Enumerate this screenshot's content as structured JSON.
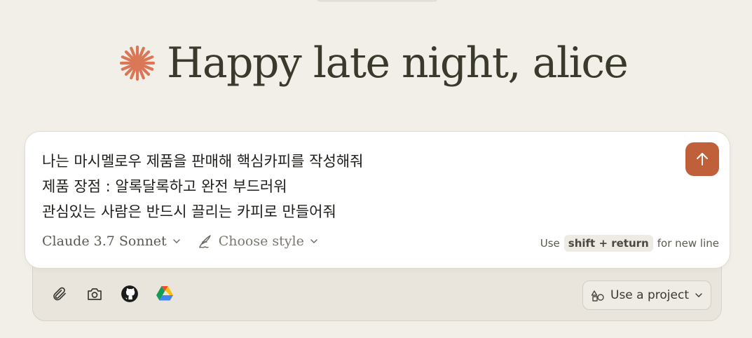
{
  "greeting": {
    "text": "Happy late night, alice"
  },
  "composer": {
    "lines": [
      "나는 마시멜로우 제품을 판매해 핵심카피를 작성해줘",
      "제품 장점 : 알록달록하고 완전 부드러워",
      "관심있는 사람은 반드시 끌리는 카피로 만들어줘"
    ],
    "model_label": "Claude 3.7 Sonnet",
    "style_label": "Choose style",
    "hint_use": "Use",
    "hint_keys": "shift + return",
    "hint_suffix": "for new line"
  },
  "project": {
    "label": "Use a project"
  },
  "colors": {
    "accent": "#c0603b",
    "logo": "#d97757",
    "background": "#f2efe9"
  },
  "icons": [
    "claude-logo-icon",
    "send-arrow-icon",
    "style-icon",
    "chevron-down-icon",
    "paperclip-icon",
    "camera-icon",
    "github-icon",
    "google-drive-icon",
    "project-icon"
  ]
}
